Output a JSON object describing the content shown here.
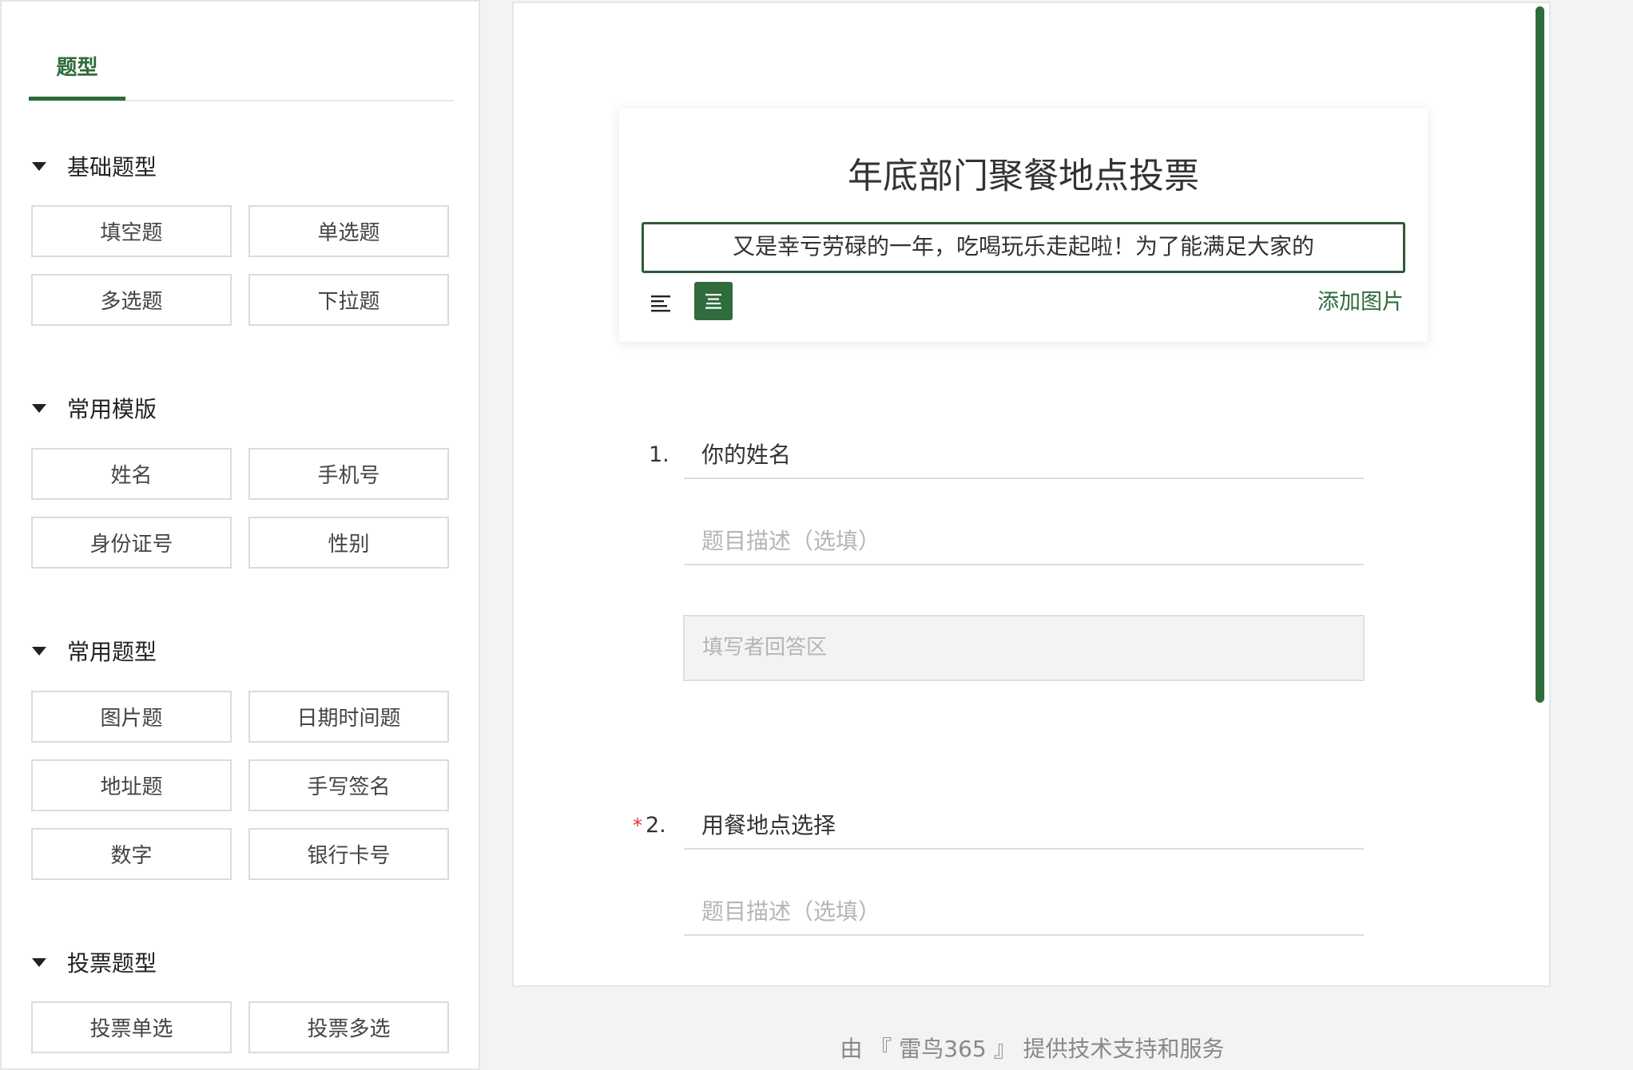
{
  "sidebar": {
    "tab_label": "题型",
    "sections": [
      {
        "title": "基础题型",
        "items": [
          "填空题",
          "单选题",
          "多选题",
          "下拉题"
        ]
      },
      {
        "title": "常用模版",
        "items": [
          "姓名",
          "手机号",
          "身份证号",
          "性别"
        ]
      },
      {
        "title": "常用题型",
        "items": [
          "图片题",
          "日期时间题",
          "地址题",
          "手写签名",
          "数字",
          "银行卡号"
        ]
      },
      {
        "title": "投票题型",
        "items": [
          "投票单选",
          "投票多选"
        ]
      }
    ]
  },
  "form": {
    "title": "年底部门聚餐地点投票",
    "description": "又是幸亏劳碌的一年，吃喝玩乐走起啦！为了能满足大家的",
    "add_image_label": "添加图片",
    "questions": [
      {
        "number": "1.",
        "required": false,
        "title": "你的姓名",
        "description_placeholder": "题目描述（选填）",
        "answer_placeholder": "填写者回答区"
      },
      {
        "number": "2.",
        "required": true,
        "required_mark": "*",
        "title": "用餐地点选择",
        "description_placeholder": "题目描述（选填）"
      }
    ]
  },
  "footer": {
    "text": "由 『 雷鸟365 』 提供技术支持和服务"
  },
  "colors": {
    "accent": "#2f6b3c",
    "required": "#dd3333",
    "page_bg": "#f2f3f5"
  },
  "icons": {
    "section_toggle": "caret-down-icon",
    "align_left": "align-left-icon",
    "align_center": "align-center-icon"
  }
}
